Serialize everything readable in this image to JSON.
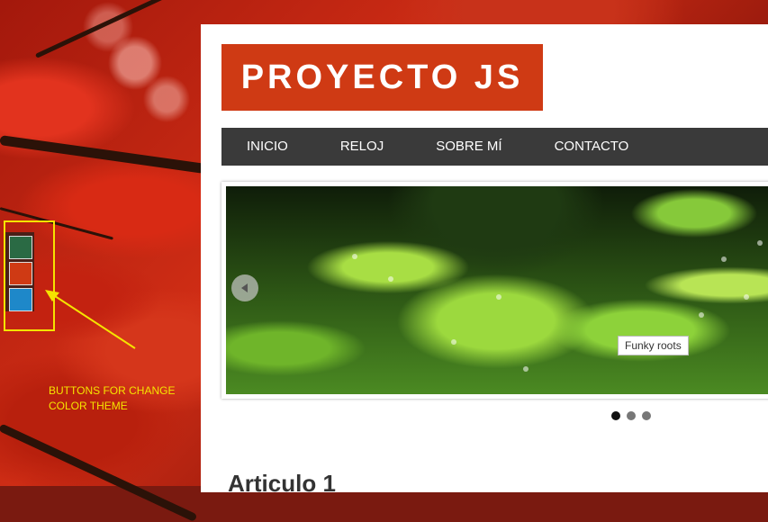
{
  "logo": {
    "text": "PROYECTO JS",
    "color": "#cf3a14"
  },
  "nav": {
    "items": [
      {
        "label": "INICIO"
      },
      {
        "label": "RELOJ"
      },
      {
        "label": "SOBRE MÍ"
      },
      {
        "label": "CONTACTO"
      }
    ],
    "background": "#3a3a3a"
  },
  "slider": {
    "caption": "Funky roots",
    "prev_icon": "chevron-left-icon",
    "dots_total": 3,
    "active_dot": 1
  },
  "article": {
    "title": "Articulo 1"
  },
  "theme_buttons": {
    "colors": [
      "#2a6a44",
      "#cf3a14",
      "#1e88c9"
    ],
    "annotation_line1": "BUTTONS FOR CHANGE",
    "annotation_line2": "COLOR THEME",
    "annotation_color": "#f5e400"
  }
}
